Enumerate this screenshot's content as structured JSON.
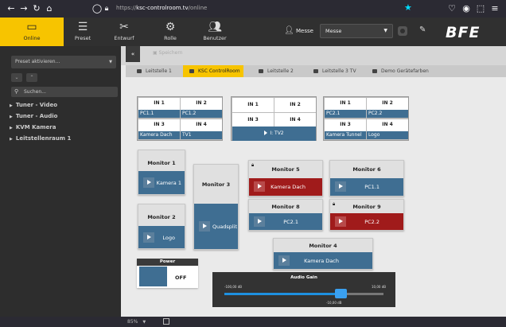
{
  "browser": {
    "url_prefix": "https://",
    "url_host": "ksc-controlroom.tv",
    "url_path": "/online"
  },
  "toolbar": {
    "online": "Online",
    "preset": "Preset",
    "entwurf": "Entwurf",
    "rolle": "Rolle",
    "benutzer": "Benutzer",
    "messe_label": "Messe",
    "messe_select": "Messe",
    "logo": "BFE"
  },
  "sidebar": {
    "preset_placeholder": "Preset aktivieren...",
    "search_placeholder": "Suchen...",
    "tree": [
      "Tuner - Video",
      "Tuner - Audio",
      "KVM Kamera",
      "Leitstellenraum 1"
    ]
  },
  "main": {
    "save_label": "Speichern",
    "tabs": [
      "Leitstelle 1",
      "KSC ControlRoom",
      "Leitstelle 2",
      "Leitstelle 3 TV",
      "Demo Gerätefarben"
    ]
  },
  "matrices": [
    {
      "cells": [
        {
          "label": "IN 1",
          "value": "PC1.1"
        },
        {
          "label": "IN 2",
          "value": "PC1.2"
        },
        {
          "label": "IN 3",
          "value": "Kamera Dach"
        },
        {
          "label": "IN 4",
          "value": "TV1"
        }
      ]
    },
    {
      "cells": [
        {
          "label": "IN 1",
          "value": ""
        },
        {
          "label": "IN 2",
          "value": ""
        },
        {
          "label": "IN 3",
          "value": ""
        },
        {
          "label": "IN 4",
          "value": ""
        }
      ],
      "output": "I: TV2"
    },
    {
      "cells": [
        {
          "label": "IN 1",
          "value": "PC2.1"
        },
        {
          "label": "IN 2",
          "value": "PC2.2"
        },
        {
          "label": "IN 3",
          "value": "Kamera Tunnel"
        },
        {
          "label": "IN 4",
          "value": "Logo"
        }
      ]
    }
  ],
  "monitors": {
    "m1": {
      "title": "Monitor 1",
      "source": "Kamera 1"
    },
    "m2": {
      "title": "Monitor 2",
      "source": "Logo"
    },
    "m3": {
      "title": "Monitor 3",
      "source": "Quadsplit"
    },
    "m4": {
      "title": "Monitor 4",
      "source": "Kamera Dach"
    },
    "m5": {
      "title": "Monitor 5",
      "source": "Kamera Dach"
    },
    "m6": {
      "title": "Monitor 6",
      "source": "PC1.1"
    },
    "m8": {
      "title": "Monitor 8",
      "source": "PC2.1"
    },
    "m9": {
      "title": "Monitor 9",
      "source": "PC2.2"
    }
  },
  "power": {
    "title": "Power",
    "state": "OFF"
  },
  "audio": {
    "title": "Audio Gain",
    "min_label": "-100,00 dB",
    "max_label": "10,00 dB",
    "current_label": "-10,00 dB",
    "level_fraction": 0.73
  },
  "status": {
    "zoom": "85%"
  },
  "colors": {
    "accent": "#f7c400",
    "tile_blue": "#3f6e92",
    "alert_red": "#a01b1b",
    "slider_blue": "#1e90e0"
  }
}
